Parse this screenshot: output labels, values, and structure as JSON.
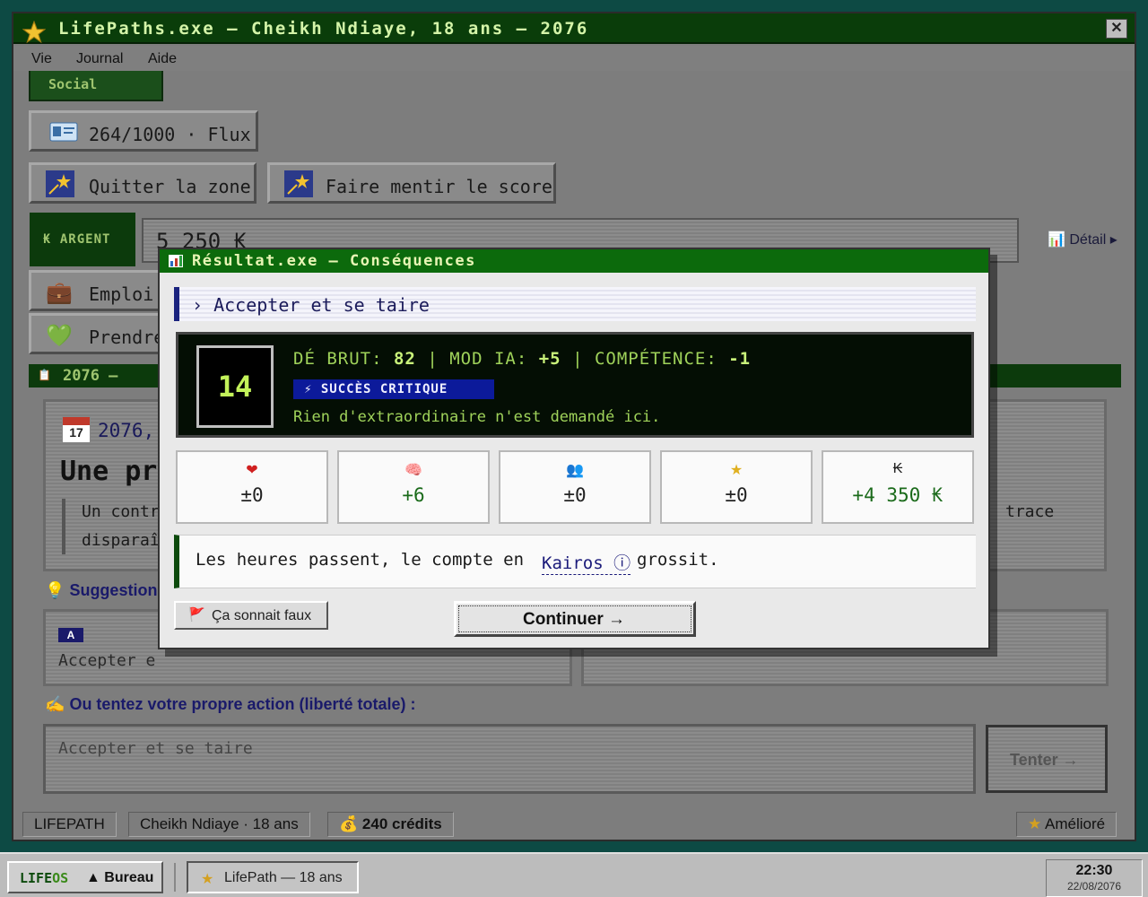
{
  "window": {
    "title": "LifePaths.exe — Cheikh Ndiaye, 18 ans — 2076",
    "close_label": "✕"
  },
  "menu": {
    "items": [
      "Vie",
      "Journal",
      "Aide"
    ]
  },
  "background": {
    "social_tab_label": "Social",
    "flux_text": "264/1000 · Flux",
    "action_buttons": [
      "Quitter la zone",
      "Faire mentir le score"
    ],
    "argent_label": "₭ ARGENT",
    "argent_value": "5 250 ₭",
    "detail_link": "Détail ▸",
    "life_buttons": [
      "Emploi",
      "Prendre"
    ],
    "year_bar": "2076 —",
    "event": {
      "date": "2076,",
      "date_icon": "July 17",
      "heading": "Une pr",
      "quote_line1_left": "Un contr",
      "quote_line1_right": "trace",
      "quote_line2": "disparaî"
    },
    "suggestions_title": "Suggestion",
    "suggestion_card": {
      "badge": "A",
      "text": "Accepter e"
    },
    "own_action_title": "Ou tentez votre propre action (liberté totale) :",
    "own_action_placeholder": "Accepter et se taire",
    "tenter_label": "Tenter →"
  },
  "statusbar": {
    "app": "LIFEPATH",
    "player": "Cheikh Ndiaye · 18 ans",
    "credits": "240 crédits",
    "tier": "Amélioré"
  },
  "modal": {
    "title": "Résultat.exe — Conséquences",
    "action": "› Accepter et se taire",
    "die_value": "14",
    "dice_prefix_raw": "DÉ BRUT:",
    "dice_raw": "82",
    "dice_prefix_ai": "| MOD IA:",
    "dice_ai": "+5",
    "dice_prefix_skill": "| COMPÉTENCE:",
    "dice_skill": "-1",
    "crit_label": "⚡ SUCCÈS CRITIQUE",
    "comment": "Rien d'extraordinaire n'est demandé ici.",
    "stats": [
      {
        "icon": "❤",
        "value": "±0",
        "color": "#222222"
      },
      {
        "icon": "🧠",
        "value": "+6",
        "color": "#1a6a1a"
      },
      {
        "icon": "👥",
        "value": "±0",
        "color": "#222222"
      },
      {
        "icon": "★",
        "value": "±0",
        "color": "#222222"
      },
      {
        "icon": "₭",
        "value": "+4 350 ₭",
        "color": "#1a6a1a"
      }
    ],
    "narration_before": "Les heures passent, le compte en",
    "narration_link": "Kairos ⓘ",
    "narration_after": "grossit.",
    "flag_label": "Ça sonnait faux",
    "continue_label": "Continuer →"
  },
  "taskbar": {
    "os_name_a": "LIFE",
    "os_name_b": "OS",
    "start_label": "▲ Bureau",
    "task_label": "LifePath — 18 ans",
    "clock_time": "22:30",
    "clock_date": "22/08/2076"
  }
}
